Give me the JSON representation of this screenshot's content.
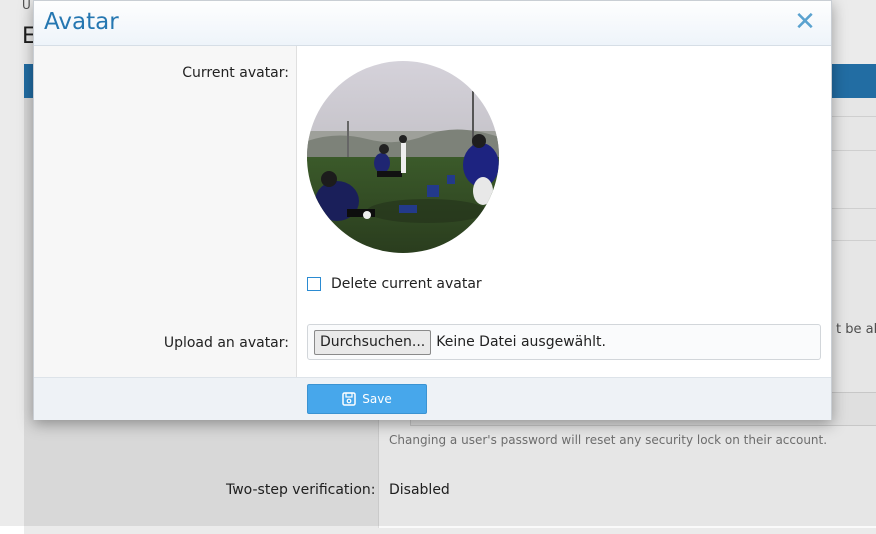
{
  "background": {
    "breadcrumb": "U",
    "page_title": "E",
    "overflow_text": "t be ab",
    "password_hint": "Changing a user's password will reset any security lock on their account.",
    "two_step_label": "Two-step verification:",
    "two_step_value": "Disabled"
  },
  "dialog": {
    "title": "Avatar",
    "close_symbol": "✕",
    "current_avatar_label": "Current avatar:",
    "delete_avatar_label": "Delete current avatar",
    "upload_label": "Upload an avatar:",
    "browse_button": "Durchsuchen...",
    "file_status": "Keine Datei ausgewählt.",
    "save_button": "Save",
    "icons": {
      "close": "close-icon",
      "save": "save-icon"
    },
    "colors": {
      "title": "#2577b1",
      "close": "#5aa2cf",
      "save_button": "#47a7eb",
      "checkbox_border": "#2b8bd2"
    }
  }
}
